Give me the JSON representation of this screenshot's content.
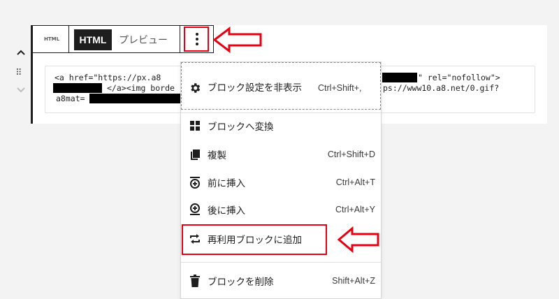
{
  "editor": {
    "block_type_icon": "HTML",
    "html_tab": "HTML",
    "preview_tab": "プレビュー",
    "code_line1_a": "<a href=\"https://px.a8",
    "code_line1_b": "\" rel=\"nofollow\">",
    "code_line2_a": "</a><img borde",
    "code_line2_b": "ps://www10.a8.net/0.gif?",
    "code_line3_a": "a8mat="
  },
  "menu": {
    "items": [
      {
        "label": "ブロック設定を非表示",
        "shortcut": "Ctrl+Shift+,",
        "icon": "gear-icon"
      },
      {
        "label": "ブロックへ変換",
        "shortcut": "",
        "icon": "grid-icon"
      },
      {
        "label": "複製",
        "shortcut": "Ctrl+Shift+D",
        "icon": "duplicate-icon"
      },
      {
        "label": "前に挿入",
        "shortcut": "Ctrl+Alt+T",
        "icon": "insert-before-icon"
      },
      {
        "label": "後に挿入",
        "shortcut": "Ctrl+Alt+Y",
        "icon": "insert-after-icon"
      },
      {
        "label": "再利用ブロックに追加",
        "shortcut": "",
        "icon": "reusable-block-icon"
      },
      {
        "label": "ブロックを削除",
        "shortcut": "Shift+Alt+Z",
        "icon": "trash-icon"
      }
    ]
  },
  "colors": {
    "highlight": "#e60012",
    "toolbar_dark": "#1e1e1e"
  }
}
